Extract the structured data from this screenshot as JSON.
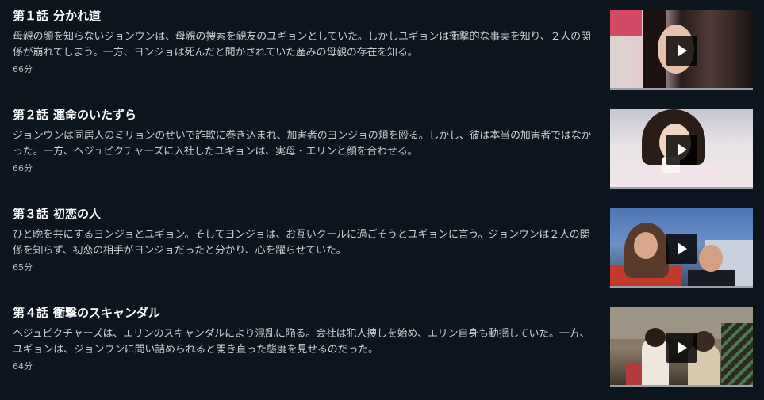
{
  "episodes": [
    {
      "number": "第１話",
      "title": "分かれ道",
      "description": "母親の顔を知らないジョンウンは、母親の捜索を親友のユギョンとしていた。しかしユギョンは衝撃的な事実を知り、２人の関係が崩れてしまう。一方、ヨンジョは死んだと聞かされていた産みの母親の存在を知る。",
      "duration": "66分",
      "thumbnail_icon": "play-icon"
    },
    {
      "number": "第２話",
      "title": "運命のいたずら",
      "description": "ジョンウンは同居人のミリョンのせいで詐欺に巻き込まれ、加害者のヨンジョの頬を殴る。しかし、彼は本当の加害者ではなかった。一方、ヘジュピクチャーズに入社したユギョンは、実母・エリンと顔を合わせる。",
      "duration": "66分",
      "thumbnail_icon": "play-icon"
    },
    {
      "number": "第３話",
      "title": "初恋の人",
      "description": "ひと晩を共にするヨンジョとユギョン。そしてヨンジョは、お互いクールに過ごそうとユギョンに言う。ジョンウンは２人の関係を知らず、初恋の相手がヨンジョだったと分かり、心を躍らせていた。",
      "duration": "65分",
      "thumbnail_icon": "play-icon"
    },
    {
      "number": "第４話",
      "title": "衝撃のスキャンダル",
      "description": "ヘジュピクチャーズは、エリンのスキャンダルにより混乱に陥る。会社は犯人捜しを始め、エリン自身も動揺していた。一方、ユギョンは、ジョンウンに問い詰められると開き直った態度を見せるのだった。",
      "duration": "64分",
      "thumbnail_icon": "play-icon"
    }
  ],
  "colors": {
    "background": "#0c141e",
    "title": "#ffffff",
    "description": "#c9ccd1",
    "duration": "#b3b7bd"
  }
}
